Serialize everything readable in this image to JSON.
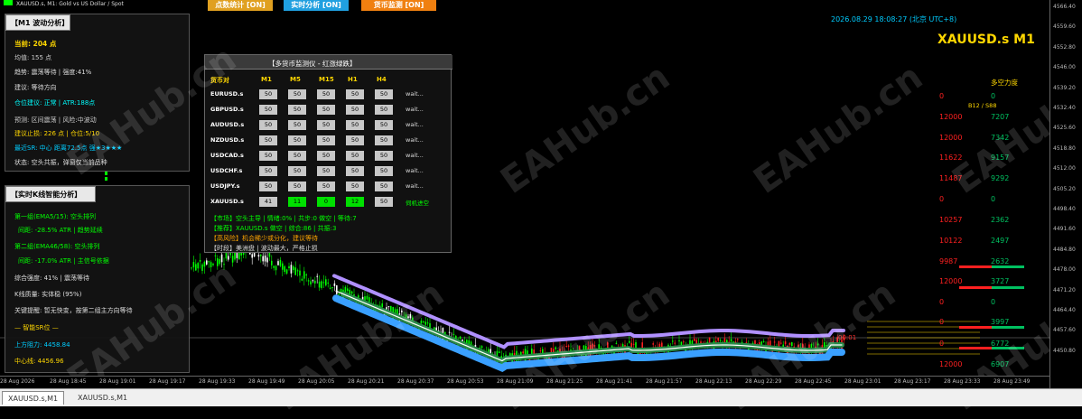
{
  "window_title": "XAUUSD.s, M1: Gold vs US Dollar / Spot",
  "top_buttons": [
    {
      "label": "点数统计 [ON]",
      "color": "#e0a020"
    },
    {
      "label": "实时分析 [ON]",
      "color": "#20a0e0"
    },
    {
      "label": "货币监测 [ON]",
      "color": "#f08010"
    }
  ],
  "datetime": "2026.08.29 18:08:27 (北京 UTC+8)",
  "symbol_title": "XAUUSD.s M1",
  "multi_force_title": "多空力度",
  "multi_force_sub": "B12 / S88",
  "panel_m1": {
    "title": "【M1 波动分析】",
    "current": "当前: 204 点",
    "average": "均值: 155 点",
    "trend": "趋势: 震荡等待 | 强度:41%",
    "advice": "建议: 等待方向",
    "position": "仓位建议: 正常 | ATR:188点",
    "forecast": "预测: 区间震荡 | 风险:中波动",
    "stop": "建议止损: 226 点 | 仓位:5/10",
    "sr": "最近SR: 中心 距离72.5点 强★3★★★",
    "status": "状态: 空头共振，弹窗仅当前品种"
  },
  "panel_k": {
    "title": "【实时K线智能分析】",
    "g1": "第一组(EMA5/15): 空头排列",
    "g1_sub": "间距: -28.5% ATR | 趋势延续",
    "g2": "第二组(EMA46/58): 空头排列",
    "g2_sub": "间距: -17.0% ATR | 主信号依据",
    "strength": "综合强度: 41% | 震荡等待",
    "quality": "K线质量: 实体稳 (95%)",
    "hint": "关键提醒: 暂无快变，按第二组主方向等待",
    "sr_title": "— 智能SR位 —",
    "resist": "上方阻力: 4458.84",
    "center": "中心线: 4456.96"
  },
  "monitor": {
    "title": "【多货币监测仪 - 红涨绿跌】",
    "headers": [
      "货币对",
      "M1",
      "M5",
      "M15",
      "H1",
      "H4"
    ],
    "rows": [
      {
        "pair": "EURUSD.s",
        "vals": [
          "50",
          "50",
          "50",
          "50",
          "50"
        ],
        "status": "wait..."
      },
      {
        "pair": "GBPUSD.s",
        "vals": [
          "50",
          "50",
          "50",
          "50",
          "50"
        ],
        "status": "wait..."
      },
      {
        "pair": "AUDUSD.s",
        "vals": [
          "50",
          "50",
          "50",
          "50",
          "50"
        ],
        "status": "wait..."
      },
      {
        "pair": "NZDUSD.s",
        "vals": [
          "50",
          "50",
          "50",
          "50",
          "50"
        ],
        "status": "wait..."
      },
      {
        "pair": "USDCAD.s",
        "vals": [
          "50",
          "50",
          "50",
          "50",
          "50"
        ],
        "status": "wait..."
      },
      {
        "pair": "USDCHF.s",
        "vals": [
          "50",
          "50",
          "50",
          "50",
          "50"
        ],
        "status": "wait..."
      },
      {
        "pair": "USDJPY.s",
        "vals": [
          "50",
          "50",
          "50",
          "50",
          "50"
        ],
        "status": "wait..."
      },
      {
        "pair": "XAUUSD.s",
        "vals": [
          "41",
          "11",
          "0",
          "12",
          "50"
        ],
        "status": "伺机进空"
      }
    ],
    "notes": [
      "【市场】空头主导 | 情绪:0% | 共步:0 做空 | 等待:7",
      "【推荐】XAUUSD.s 做空 | 综合:86 | 共振:3",
      "【高风险】机会稀少或分化，建议等待",
      "【时段】美洲盘 | 波动最大，严格止损"
    ]
  },
  "right_rows": [
    {
      "left": "0",
      "right": "0"
    },
    {
      "left": "12000",
      "right": "7207"
    },
    {
      "left": "12000",
      "right": "7342"
    },
    {
      "left": "11622",
      "right": "9157"
    },
    {
      "left": "11487",
      "right": "9292"
    },
    {
      "left": "0",
      "right": "0"
    },
    {
      "left": "10257",
      "right": "2362"
    },
    {
      "left": "10122",
      "right": "2497"
    },
    {
      "left": "9987",
      "right": "2632"
    },
    {
      "left": "12000",
      "right": "3727"
    },
    {
      "left": "0",
      "right": "0"
    },
    {
      "left": "0",
      "right": "3997"
    },
    {
      "left": "0",
      "right": "6772"
    },
    {
      "left": "12000",
      "right": "6907"
    }
  ],
  "price_tag": "00:01",
  "price_labels": [
    "4566.40",
    "4559.60",
    "4552.80",
    "4546.00",
    "4539.20",
    "4532.40",
    "4525.60",
    "4518.80",
    "4512.00",
    "4505.20",
    "4498.40",
    "4491.60",
    "4484.80",
    "4478.00",
    "4471.20",
    "4464.40",
    "4457.60",
    "4450.80"
  ],
  "time_labels": [
    "28 Aug 2026",
    "28 Aug 18:45",
    "28 Aug 19:01",
    "28 Aug 19:17",
    "28 Aug 19:33",
    "28 Aug 19:49",
    "28 Aug 20:05",
    "28 Aug 20:21",
    "28 Aug 20:37",
    "28 Aug 20:53",
    "28 Aug 21:09",
    "28 Aug 21:25",
    "28 Aug 21:41",
    "28 Aug 21:57",
    "28 Aug 22:13",
    "28 Aug 22:29",
    "28 Aug 22:45",
    "28 Aug 23:01",
    "28 Aug 23:17",
    "28 Aug 23:33",
    "28 Aug 23:49"
  ],
  "tabs": [
    "XAUUSD.s,M1",
    "XAUUSD.s,M1"
  ],
  "watermark": "EAHub.cn",
  "colors": {
    "title_yellow": "#ffd700",
    "green": "#00ff00",
    "red": "#ff2020",
    "cyan": "#00ccff",
    "orange": "#ffa500"
  }
}
